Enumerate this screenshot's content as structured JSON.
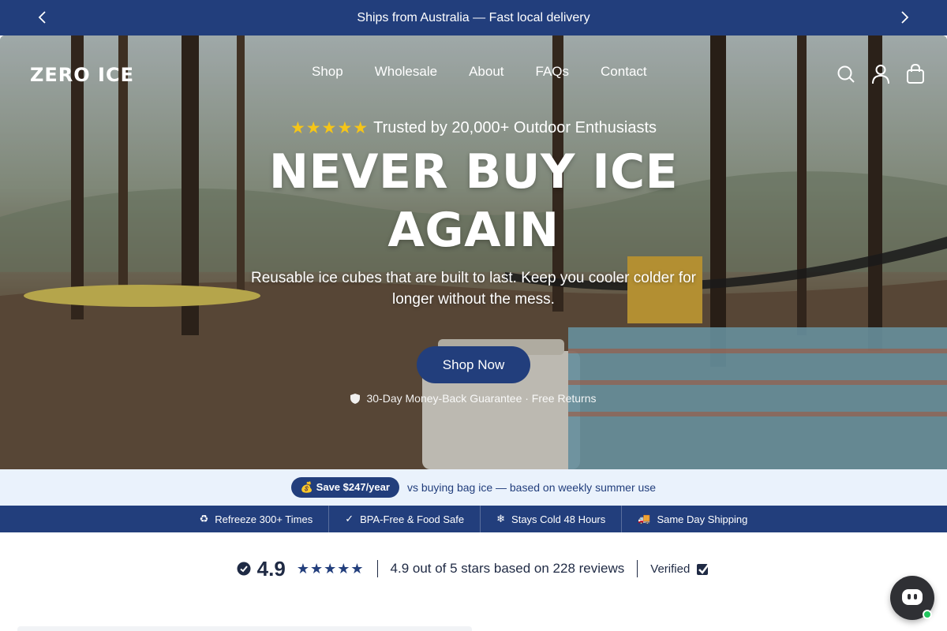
{
  "announcement": {
    "text": "Ships from Australia — Fast local delivery",
    "prev_icon": "chevron-left-icon",
    "next_icon": "chevron-right-icon"
  },
  "header": {
    "logo": "ZERO ICE",
    "nav": [
      "Shop",
      "Wholesale",
      "About",
      "FAQs",
      "Contact"
    ],
    "icons": [
      "search-icon",
      "account-icon",
      "cart-icon"
    ]
  },
  "hero": {
    "trust_stars": "★★★★★",
    "trust_text": "Trusted by 20,000+ Outdoor Enthusiasts",
    "headline": "NEVER BUY ICE AGAIN",
    "subhead": "Reusable ice cubes that are built to last. Keep you cooler colder for longer without the mess.",
    "cta": "Shop Now",
    "guarantee": "30-Day Money-Back Guarantee · Free Returns",
    "background_alt": "Forest campsite with a cooler, paddle board and hammock"
  },
  "savings": {
    "badge": "💰 Save $247/year",
    "text": "vs buying bag ice — based on weekly summer use"
  },
  "features": [
    {
      "icon": "♻",
      "label": "Refreeze 300+ Times"
    },
    {
      "icon": "✓",
      "label": "BPA-Free & Food Safe"
    },
    {
      "icon": "❄",
      "label": "Stays Cold 48 Hours"
    },
    {
      "icon": "🚚",
      "label": "Same Day Shipping"
    }
  ],
  "reviews": {
    "rating": "4.9",
    "stars": "★★★★★",
    "summary": "4.9 out of 5 stars based on 228 reviews",
    "verified": "Verified"
  },
  "colors": {
    "brand": "#223e7c",
    "savings_bg": "#eaf2fc",
    "star_gold": "#f5c518",
    "online_dot": "#22c55e"
  }
}
